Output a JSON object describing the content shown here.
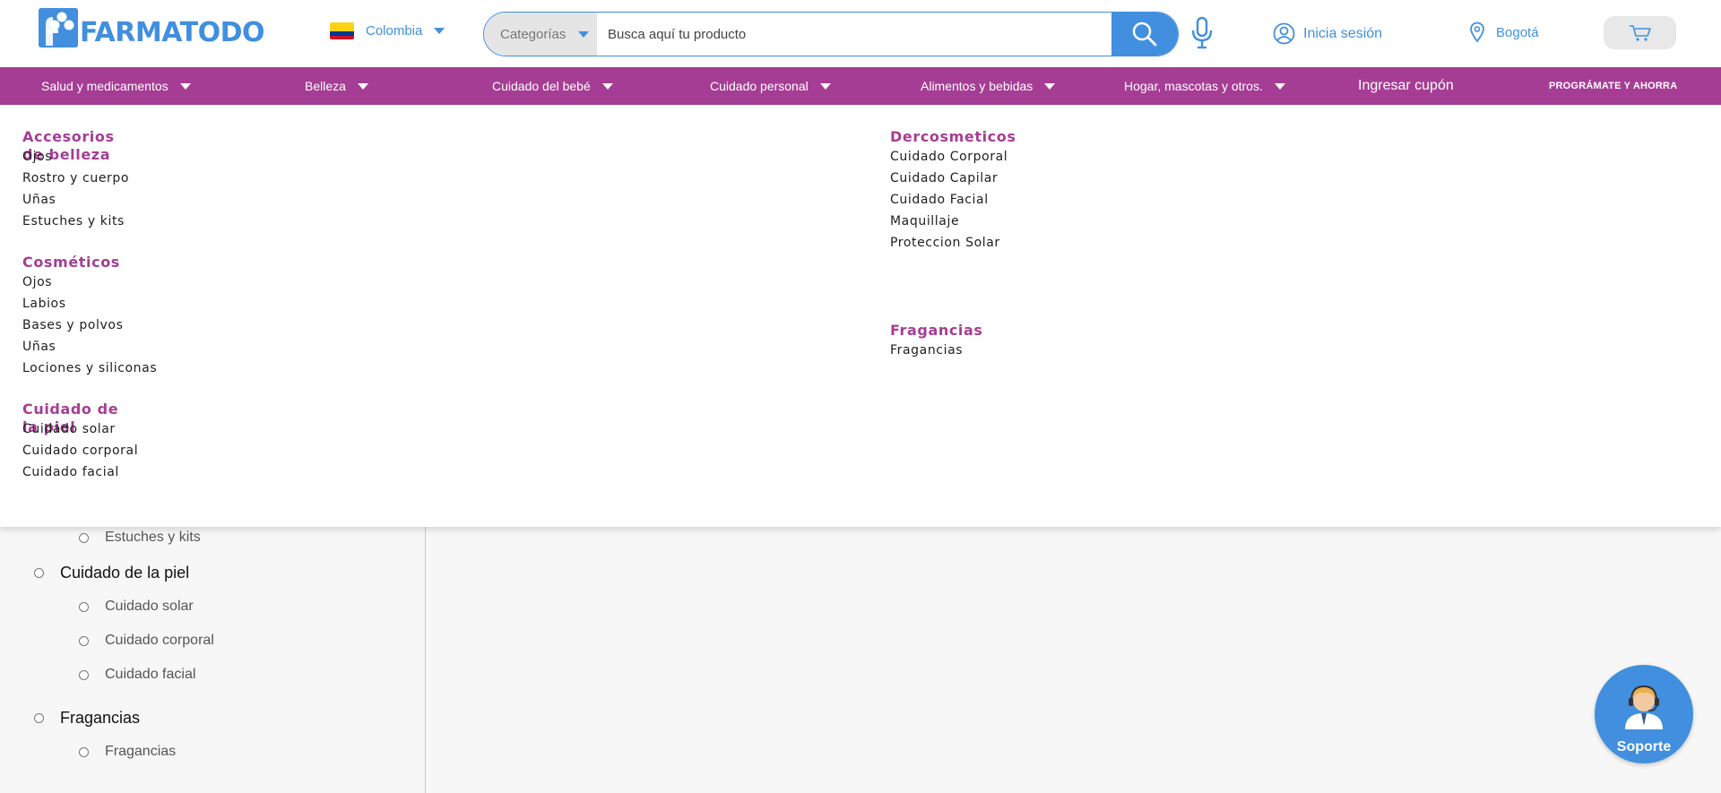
{
  "brand": {
    "name": "FARMATODO",
    "accent": "#418fde",
    "nav_color": "#a63d94"
  },
  "header": {
    "country": "Colombia",
    "search": {
      "category_label": "Categorías",
      "placeholder": "Busca aquí tu producto"
    },
    "login_label": "Inicia sesión",
    "city": "Bogotá",
    "icons": [
      "search-icon",
      "microphone-icon",
      "user-icon",
      "location-pin-icon",
      "cart-icon"
    ]
  },
  "nav": {
    "items": [
      {
        "label": "Salud y medicamentos"
      },
      {
        "label": "Belleza"
      },
      {
        "label": "Cuidado del bebé"
      },
      {
        "label": "Cuidado personal"
      },
      {
        "label": "Alimentos y bebidas"
      },
      {
        "label": "Hogar, mascotas y otros."
      }
    ],
    "coupon_label": "Ingresar cupón",
    "promo_label": "PROGRÁMATE Y AHORRA"
  },
  "mega_menu": {
    "left": [
      {
        "title": "Accesorios de belleza",
        "links": [
          "Ojos",
          "Rostro y cuerpo",
          "Uñas",
          "Estuches y kits"
        ]
      },
      {
        "title": "Cosméticos",
        "links": [
          "Ojos",
          "Labios",
          "Bases y polvos",
          "Uñas",
          "Lociones y siliconas"
        ]
      },
      {
        "title": "Cuidado de la piel",
        "links": [
          "Cuidado solar",
          "Cuidado corporal",
          "Cuidado facial"
        ]
      }
    ],
    "right": [
      {
        "title": "Dercosmeticos",
        "links": [
          "Cuidado Corporal",
          "Cuidado Capilar",
          "Cuidado Facial",
          "Maquillaje",
          "Proteccion Solar"
        ]
      },
      {
        "title": "Fragancias",
        "links": [
          "Fragancias"
        ]
      }
    ]
  },
  "sidebar": {
    "items": [
      {
        "label": "Estuches y kits",
        "level": 2
      },
      {
        "label": "Cuidado de la piel",
        "level": 1
      },
      {
        "label": "Cuidado solar",
        "level": 2
      },
      {
        "label": "Cuidado corporal",
        "level": 2
      },
      {
        "label": "Cuidado facial",
        "level": 2
      },
      {
        "label": "Fragancias",
        "level": 1
      },
      {
        "label": "Fragancias",
        "level": 2
      }
    ]
  },
  "support": {
    "label": "Soporte"
  }
}
